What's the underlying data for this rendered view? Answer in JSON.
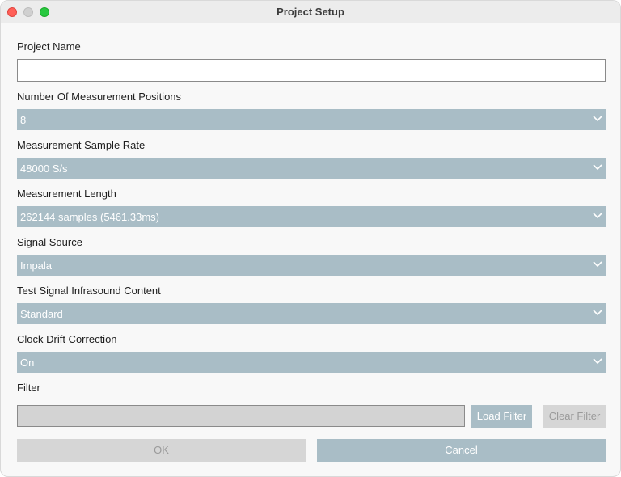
{
  "window": {
    "title": "Project Setup"
  },
  "form": {
    "project_name": {
      "label": "Project Name",
      "value": ""
    },
    "measurement_positions": {
      "label": "Number Of Measurement Positions",
      "value": "8"
    },
    "sample_rate": {
      "label": "Measurement Sample Rate",
      "value": "48000 S/s"
    },
    "measurement_length": {
      "label": "Measurement Length",
      "value": "262144 samples (5461.33ms)"
    },
    "signal_source": {
      "label": "Signal Source",
      "value": "Impala"
    },
    "infrasound_content": {
      "label": "Test Signal Infrasound Content",
      "value": "Standard"
    },
    "clock_drift": {
      "label": "Clock Drift Correction",
      "value": "On"
    },
    "filter": {
      "label": "Filter",
      "value": ""
    }
  },
  "buttons": {
    "load_filter": "Load Filter",
    "clear_filter": "Clear Filter",
    "ok": "OK",
    "cancel": "Cancel"
  },
  "colors": {
    "select_bg": "#a9bdc6",
    "disabled_bg": "#d6d6d6",
    "close": "#ff5f57",
    "maximize": "#28c840"
  }
}
